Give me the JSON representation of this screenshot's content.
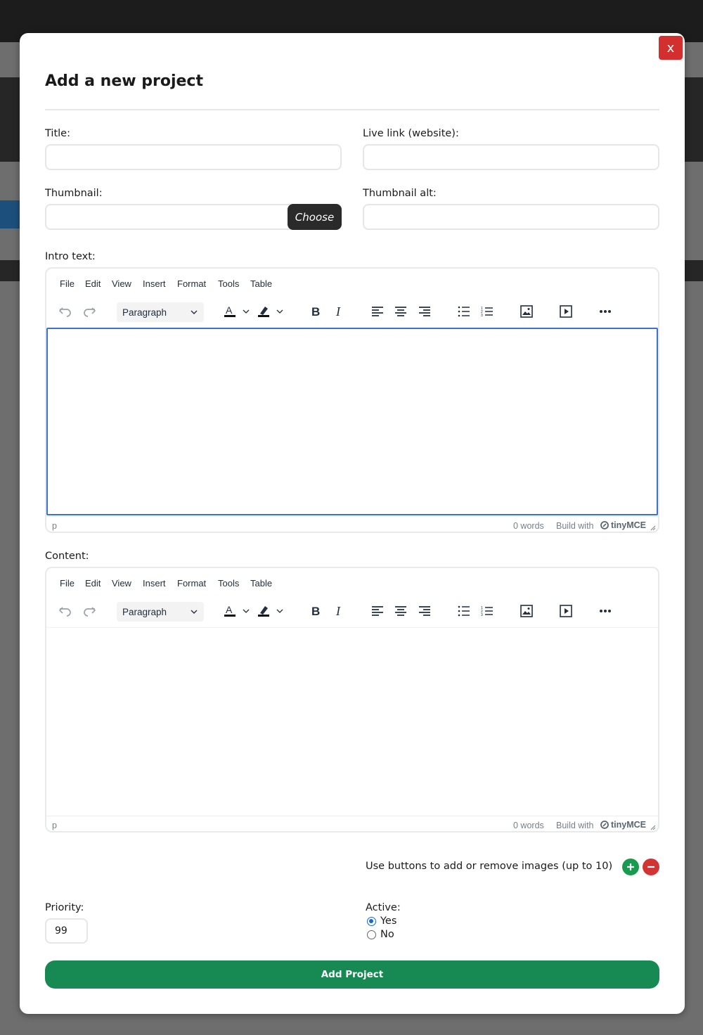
{
  "modal": {
    "title": "Add a new project",
    "close_label": "x"
  },
  "fields": {
    "title_label": "Title:",
    "title_value": "",
    "live_link_label": "Live link (website):",
    "live_link_value": "",
    "thumbnail_label": "Thumbnail:",
    "thumbnail_value": "",
    "choose_label": "Choose",
    "thumbnail_alt_label": "Thumbnail alt:",
    "thumbnail_alt_value": ""
  },
  "editor_menu": [
    "File",
    "Edit",
    "View",
    "Insert",
    "Format",
    "Tools",
    "Table"
  ],
  "intro_editor": {
    "label": "Intro text:",
    "block_format": "Paragraph",
    "path": "p",
    "word_count": "0 words",
    "build_with": "Build with",
    "brand": "tinyMCE"
  },
  "content_editor": {
    "label": "Content:",
    "block_format": "Paragraph",
    "path": "p",
    "word_count": "0 words",
    "build_with": "Build with",
    "brand": "tinyMCE"
  },
  "toolbar_icons": [
    "undo-icon",
    "redo-icon",
    "text-color-icon",
    "highlight-color-icon",
    "bold-icon",
    "italic-icon",
    "align-left-icon",
    "align-center-icon",
    "align-right-icon",
    "bullet-list-icon",
    "numbered-list-icon",
    "image-icon",
    "media-icon",
    "more-icon"
  ],
  "images": {
    "note": "Use buttons to add or remove images (up to 10)",
    "add_icon": "plus-icon",
    "remove_icon": "minus-icon"
  },
  "priority": {
    "label": "Priority:",
    "value": "99"
  },
  "active": {
    "label": "Active:",
    "options": [
      {
        "label": "Yes",
        "checked": true
      },
      {
        "label": "No",
        "checked": false
      }
    ]
  },
  "submit_label": "Add Project",
  "colors": {
    "close": "#d32f2f",
    "submit": "#178a54",
    "add": "#1a9a4f",
    "remove": "#d23434",
    "focus": "#3a73c9"
  }
}
